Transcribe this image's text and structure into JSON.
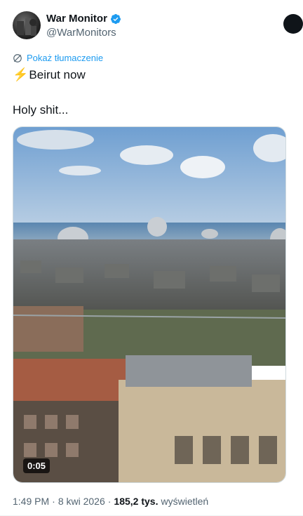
{
  "author": {
    "name": "War Monitor",
    "handle": "@WarMonitors",
    "verified_icon": "verified-badge-icon",
    "brand_color": "#1d9bf0"
  },
  "translate_link": "Pokaż tłumaczenie",
  "tweet": {
    "line1_emoji": "⚡",
    "line1_text": "Beirut now",
    "line2_text": "Holy shit..."
  },
  "media": {
    "type": "video",
    "duration": "0:05"
  },
  "meta": {
    "time": "1:49 PM",
    "separator": "·",
    "date": "8 kwi 2026",
    "views_count": "185,2 tys.",
    "views_label": "wyświetleń"
  }
}
